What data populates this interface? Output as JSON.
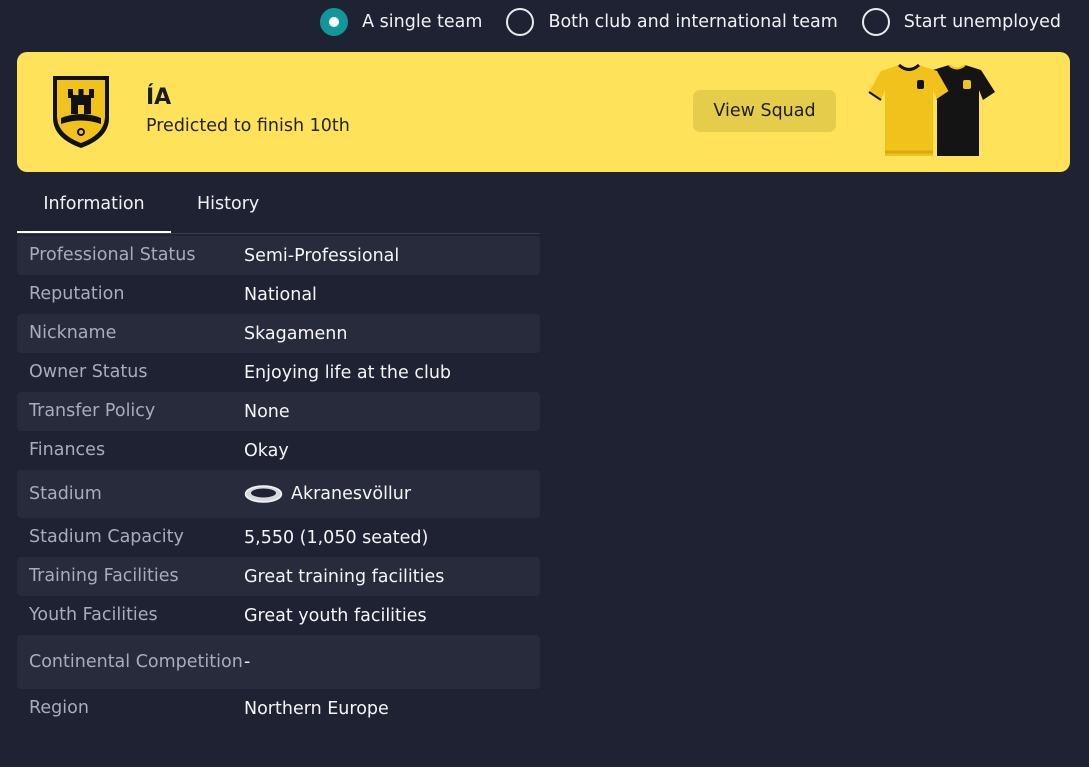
{
  "radio_options": [
    {
      "label": "A single team",
      "selected": true
    },
    {
      "label": "Both club and international team",
      "selected": false
    },
    {
      "label": "Start unemployed",
      "selected": false
    }
  ],
  "club": {
    "name": "ÍA",
    "prediction": "Predicted to finish 10th",
    "view_squad_label": "View Squad",
    "colors": {
      "primary": "#fde25a",
      "kit_home": "#f2c21c",
      "kit_away": "#111111"
    }
  },
  "tabs": [
    {
      "label": "Information",
      "active": true
    },
    {
      "label": "History",
      "active": false
    }
  ],
  "info_rows": [
    {
      "label": "Professional Status",
      "value": "Semi-Professional"
    },
    {
      "label": "Reputation",
      "value": "National"
    },
    {
      "label": "Nickname",
      "value": "Skagamenn"
    },
    {
      "label": "Owner Status",
      "value": "Enjoying life at the club"
    },
    {
      "label": "Transfer Policy",
      "value": "None"
    },
    {
      "label": "Finances",
      "value": "Okay"
    },
    {
      "label": "Stadium",
      "value": "Akranesvöllur",
      "icon": "stadium-icon"
    },
    {
      "label": "Stadium Capacity",
      "value": "5,550 (1,050 seated)"
    },
    {
      "label": "Training Facilities",
      "value": "Great training facilities"
    },
    {
      "label": "Youth Facilities",
      "value": "Great youth facilities"
    },
    {
      "label": "Continental Competition",
      "value": "-"
    },
    {
      "label": "Region",
      "value": "Northern Europe"
    }
  ]
}
